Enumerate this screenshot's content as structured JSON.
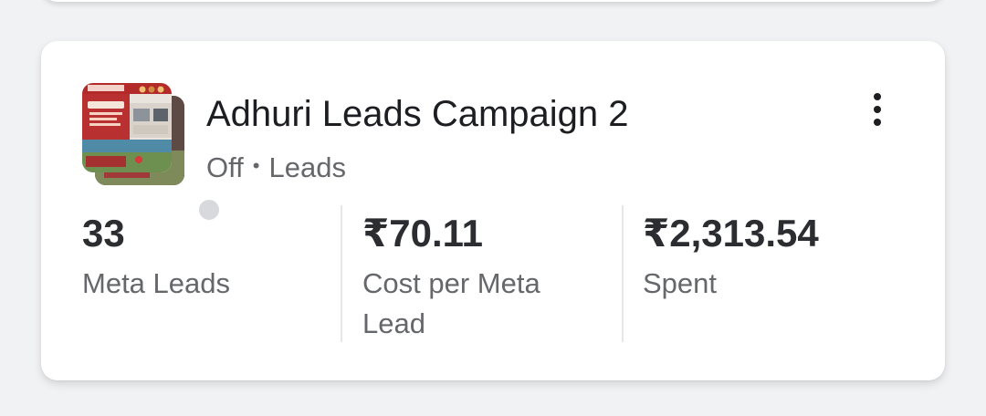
{
  "campaign": {
    "name": "Adhuri Leads Campaign 2",
    "status": "Off",
    "separator": "•",
    "objective": "Leads"
  },
  "metrics": [
    {
      "value": "33",
      "label": "Meta Leads"
    },
    {
      "value": "₹70.11",
      "label": "Cost per Meta Lead"
    },
    {
      "value": "₹2,313.54",
      "label": "Spent"
    }
  ],
  "icons": {
    "more": "more-vertical-icon",
    "status": "status-off-dot"
  },
  "colors": {
    "status_off": "#d8d9dc",
    "secondary_text": "#65676b",
    "primary_text": "#1c1e21"
  }
}
